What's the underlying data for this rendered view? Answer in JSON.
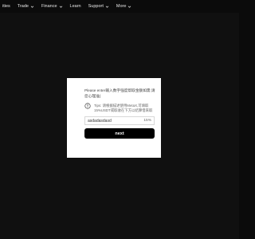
{
  "nav": {
    "items": [
      {
        "label": "ities",
        "has_dropdown": false
      },
      {
        "label": "Trade",
        "has_dropdown": true
      },
      {
        "label": "Finance",
        "has_dropdown": true
      },
      {
        "label": "Learn",
        "has_dropdown": false
      },
      {
        "label": "Support",
        "has_dropdown": true
      },
      {
        "label": "More",
        "has_dropdown": true
      }
    ]
  },
  "modal": {
    "message": "Please enter输入数字强度帮取金额如需,请您心理准(",
    "tips": "Tips: 请根据描述使用MetaX,可填取15%USDT或取收在下方以结算借来取",
    "input_value": "asdadasdasd",
    "input_suffix": "15%",
    "button_label": "next"
  },
  "colors": {
    "background": "#0b0b0b",
    "modal_bg": "#ffffff",
    "button_bg": "#000000",
    "button_text": "#ffffff"
  }
}
